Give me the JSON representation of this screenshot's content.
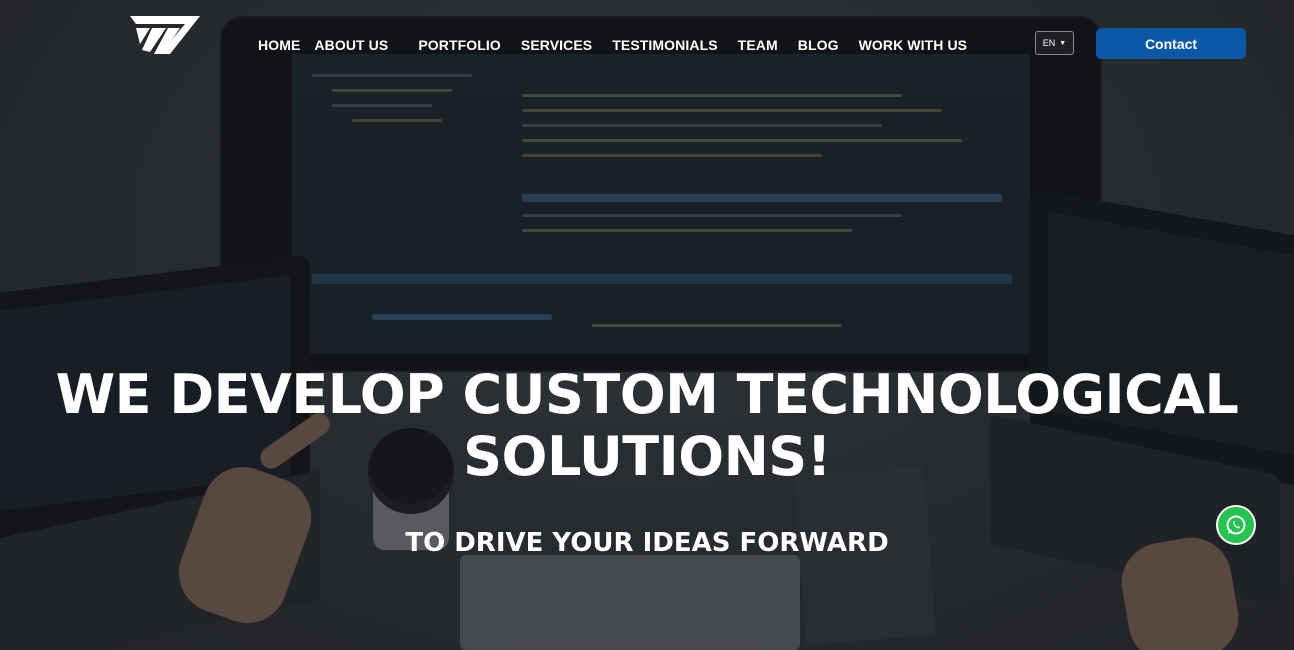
{
  "header": {
    "logo_icon": "brand-logo-icon",
    "nav_items": [
      {
        "label": "HOME"
      },
      {
        "label": "ABOUT US"
      },
      {
        "label": "PORTFOLIO"
      },
      {
        "label": "SERVICES"
      },
      {
        "label": "TESTIMONIALS"
      },
      {
        "label": "TEAM"
      },
      {
        "label": "BLOG"
      },
      {
        "label": "WORK WITH US"
      }
    ],
    "language": {
      "selected": "EN",
      "icon": "caret-down-icon"
    },
    "contact_label": "Contact"
  },
  "hero": {
    "headline_line1": "WE DEVELOP CUSTOM TECHNOLOGICAL",
    "headline_line2": "SOLUTIONS!",
    "subheadline": "TO DRIVE YOUR IDEAS FORWARD"
  },
  "floating": {
    "whatsapp_icon": "whatsapp-icon"
  },
  "colors": {
    "accent": "#0c57a6",
    "whatsapp": "#25c34f",
    "text": "#ffffff"
  }
}
